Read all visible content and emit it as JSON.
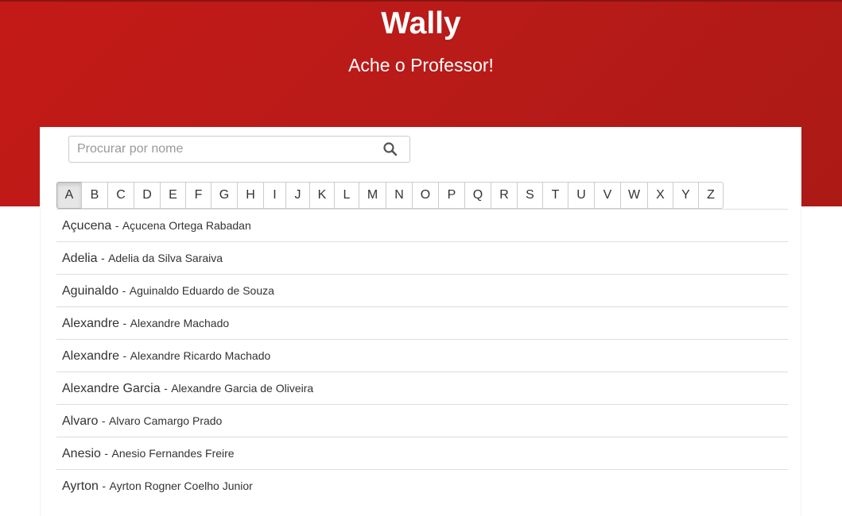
{
  "header": {
    "title": "Wally",
    "subtitle": "Ache o Professor!"
  },
  "search": {
    "placeholder": "Procurar por nome",
    "value": "",
    "icon": "search-icon"
  },
  "letters": {
    "active": "A",
    "items": [
      "A",
      "B",
      "C",
      "D",
      "E",
      "F",
      "G",
      "H",
      "I",
      "J",
      "K",
      "L",
      "M",
      "N",
      "O",
      "P",
      "Q",
      "R",
      "S",
      "T",
      "U",
      "V",
      "W",
      "X",
      "Y",
      "Z"
    ]
  },
  "professors": [
    {
      "nickname": "Açucena",
      "separator": "-",
      "full_name": "Açucena Ortega Rabadan"
    },
    {
      "nickname": "Adelia",
      "separator": "-",
      "full_name": "Adelia da Silva Saraiva"
    },
    {
      "nickname": "Aguinaldo",
      "separator": "-",
      "full_name": "Aguinaldo Eduardo de Souza"
    },
    {
      "nickname": "Alexandre",
      "separator": "-",
      "full_name": "Alexandre Machado"
    },
    {
      "nickname": "Alexandre",
      "separator": "-",
      "full_name": "Alexandre Ricardo Machado"
    },
    {
      "nickname": "Alexandre Garcia",
      "separator": "-",
      "full_name": "Alexandre Garcia de Oliveira"
    },
    {
      "nickname": "Alvaro",
      "separator": "-",
      "full_name": "Alvaro Camargo Prado"
    },
    {
      "nickname": "Anesio",
      "separator": "-",
      "full_name": "Anesio Fernandes Freire"
    },
    {
      "nickname": "Ayrton",
      "separator": "-",
      "full_name": "Ayrton Rogner Coelho Junior"
    }
  ],
  "colors": {
    "header_background": "#b81b18",
    "text": "#333333",
    "border": "#dddddd"
  }
}
